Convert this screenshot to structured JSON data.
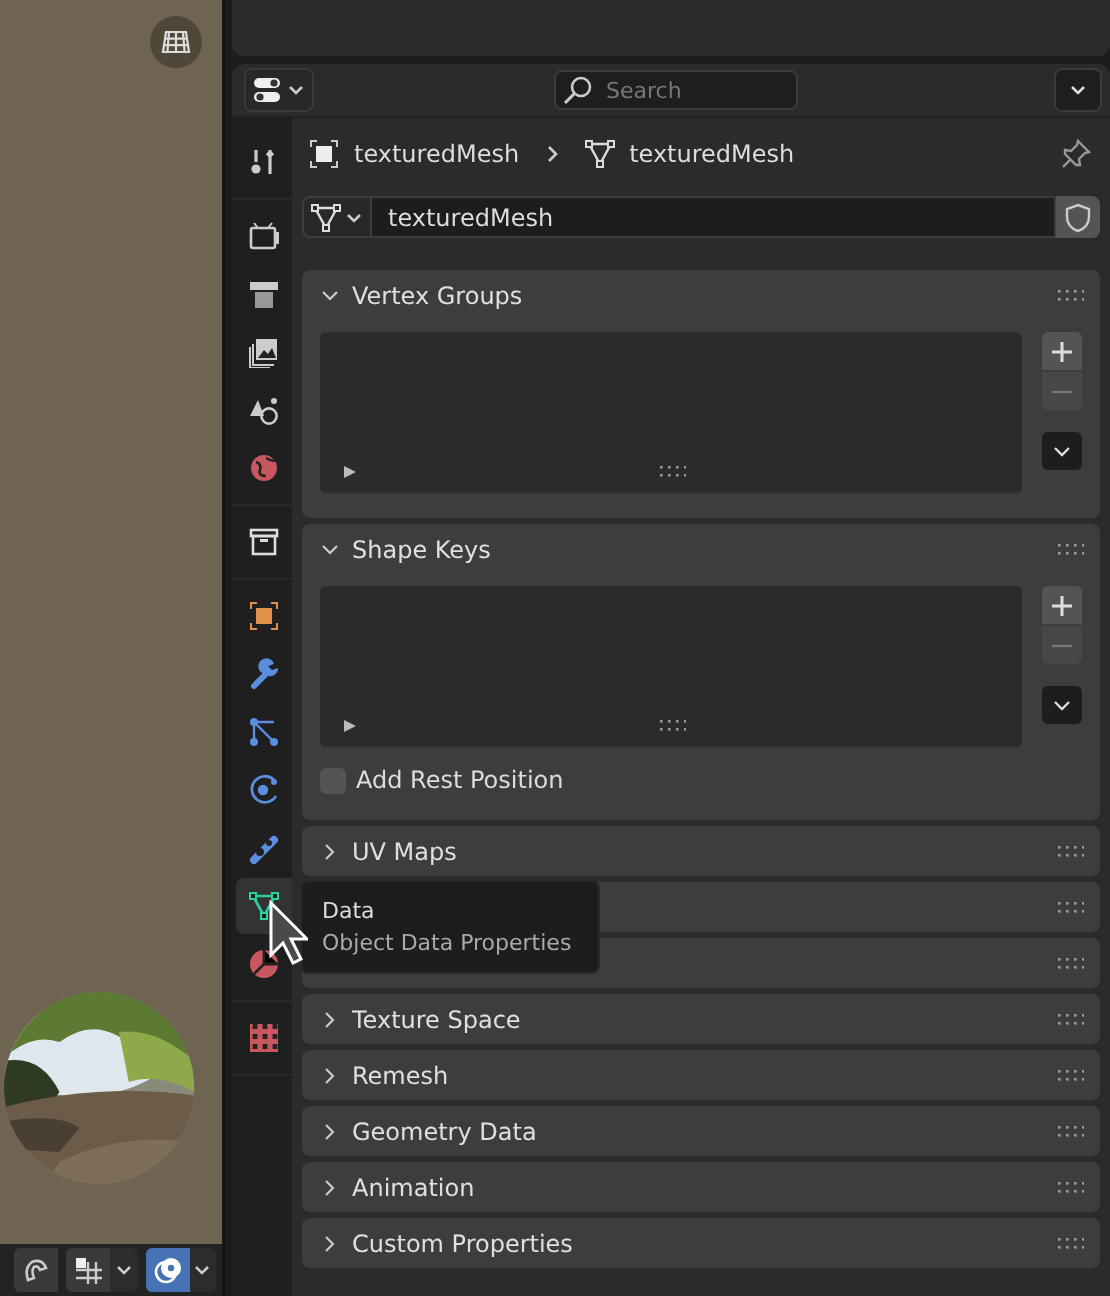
{
  "viewport_toolbar": [
    {
      "kind": "snap",
      "on": false
    },
    {
      "kind": "grid",
      "on": false
    },
    {
      "kind": "overlay",
      "on": true
    }
  ],
  "header": {
    "search": {
      "placeholder": "Search"
    }
  },
  "tabs": [
    {
      "kind": "tool",
      "selected": false
    },
    {
      "kind": "render",
      "selected": false
    },
    {
      "kind": "output",
      "selected": false
    },
    {
      "kind": "view_layer",
      "selected": false
    },
    {
      "kind": "scene",
      "selected": false
    },
    {
      "kind": "world",
      "selected": false
    },
    {
      "kind": "collection",
      "selected": false
    },
    {
      "kind": "object",
      "selected": false
    },
    {
      "kind": "modifiers",
      "selected": false
    },
    {
      "kind": "particles",
      "selected": false
    },
    {
      "kind": "physics",
      "selected": false
    },
    {
      "kind": "constraints",
      "selected": false
    },
    {
      "kind": "data",
      "selected": true
    },
    {
      "kind": "material",
      "selected": false
    },
    {
      "kind": "texture",
      "selected": false
    }
  ],
  "breadcrumb": [
    {
      "kind": "object",
      "label": "texturedMesh"
    },
    {
      "kind": "mesh",
      "label": "texturedMesh"
    }
  ],
  "datablock": {
    "name": "texturedMesh"
  },
  "panels": [
    {
      "kind": "list",
      "title": "Vertex Groups",
      "expanded": true
    },
    {
      "kind": "list",
      "title": "Shape Keys",
      "expanded": true,
      "checkbox": {
        "label": "Add Rest Position",
        "checked": false
      }
    },
    {
      "kind": "plain",
      "title": "UV Maps",
      "expanded": false
    },
    {
      "kind": "plain",
      "expanded": false
    },
    {
      "kind": "plain",
      "expanded": false
    },
    {
      "kind": "plain",
      "title": "Texture Space",
      "expanded": false
    },
    {
      "kind": "plain",
      "title": "Remesh",
      "expanded": false
    },
    {
      "kind": "plain",
      "title": "Geometry Data",
      "expanded": false
    },
    {
      "kind": "plain",
      "title": "Animation",
      "expanded": false
    },
    {
      "kind": "plain",
      "title": "Custom Properties",
      "expanded": false
    }
  ],
  "tooltip": {
    "title": "Data",
    "description": "Object Data Properties"
  }
}
